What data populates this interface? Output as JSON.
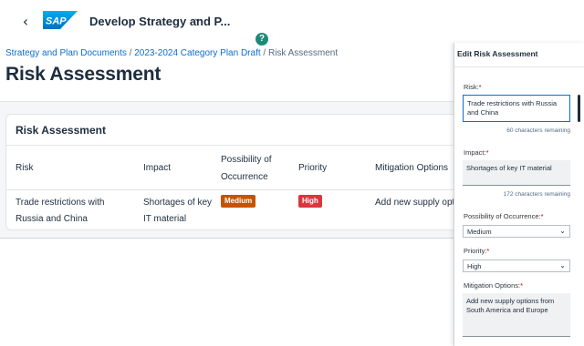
{
  "shell": {
    "back_icon": "chevron-left-icon",
    "logo_text": "SAP",
    "app_title": "Develop Strategy and P...",
    "title_menu_icon": "chevron-down-icon",
    "help_icon": "help-icon",
    "help_glyph": "?"
  },
  "breadcrumb": {
    "items": [
      "Strategy and Plan Documents",
      "2023-2024 Category Plan Draft"
    ],
    "separator": "/",
    "current": "Risk Assessment"
  },
  "page": {
    "title": "Risk Assessment"
  },
  "table": {
    "title": "Risk Assessment",
    "columns": [
      "Risk",
      "Impact",
      "Possibility of Occurrence",
      "Priority",
      "Mitigation Options"
    ],
    "rows": [
      {
        "risk": "Trade restrictions with Russia and China",
        "impact": "Shortages of key IT material",
        "possibility": "Medium",
        "priority": "High",
        "mitigation": "Add new supply options"
      }
    ]
  },
  "edit_panel": {
    "title": "Edit Risk Assessment",
    "risk_label": "Risk:",
    "risk_value": "Trade restrictions with Russia and China",
    "risk_counter": "60 characters remaining",
    "impact_label": "Impact:",
    "impact_value": "Shortages of key IT material",
    "impact_counter": "172 characters remaining",
    "possibility_label": "Possibility of Occurrence:",
    "possibility_value": "Medium",
    "priority_label": "Priority:",
    "priority_value": "High",
    "mitigation_label": "Mitigation Options:",
    "mitigation_value": "Add new supply options from South America and Europe",
    "required_marker": "*"
  },
  "colors": {
    "brand_blue": "#0a6ed1",
    "medium_badge": "#c35500",
    "high_badge": "#d9363e",
    "help_green": "#1d8a77"
  }
}
